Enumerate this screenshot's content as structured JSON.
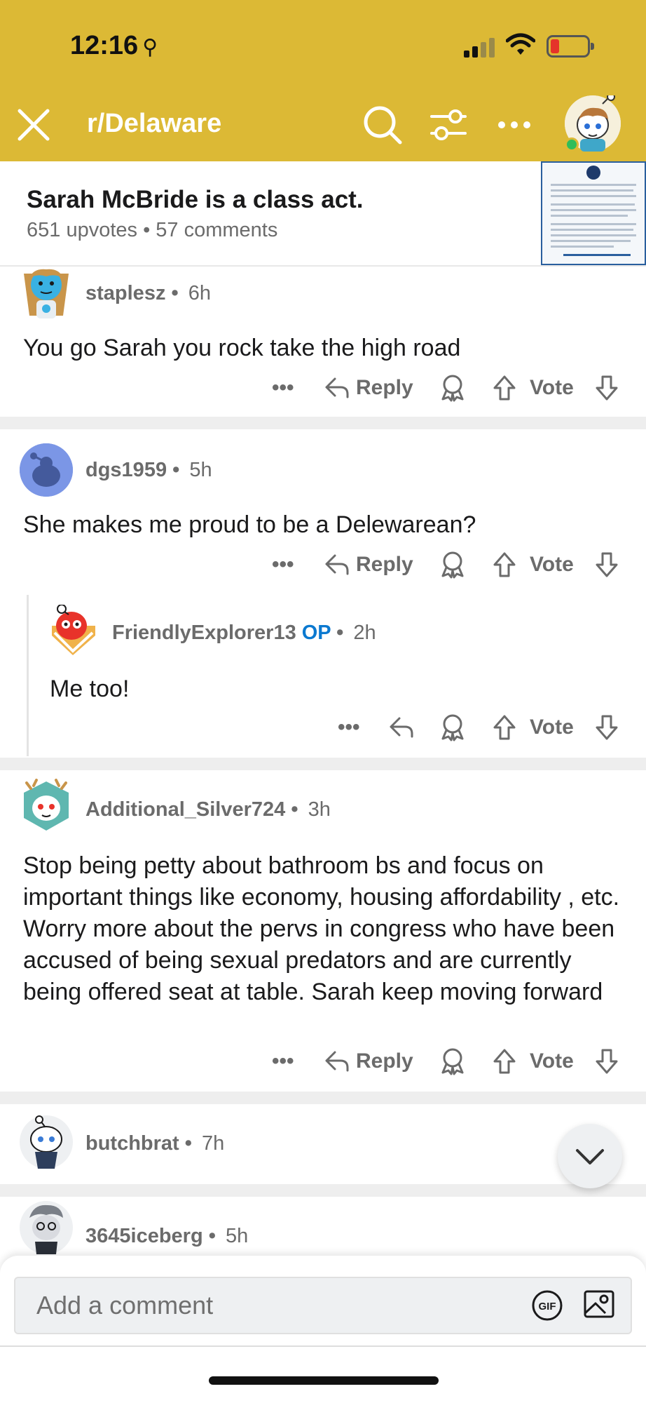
{
  "status_bar": {
    "time": "12:16",
    "pin_glyph": "⚲",
    "battery_color": "#e5332a"
  },
  "header": {
    "subreddit": "r/Delaware",
    "bg_color": "#dcb935"
  },
  "post": {
    "title": "Sarah McBride is a class act.",
    "upvotes": "651 upvotes",
    "separator": "•",
    "comments": "57 comments"
  },
  "actions": {
    "reply": "Reply",
    "vote": "Vote",
    "more": "•••"
  },
  "comments": [
    {
      "user": "staplesz",
      "time": "6h",
      "body": "You go Sarah you rock take the high road"
    },
    {
      "user": "dgs1959",
      "time": "5h",
      "body": "She makes me proud to be a Delewarean?"
    },
    {
      "user": "FriendlyExplorer13",
      "op": "OP",
      "time": "2h",
      "body": "Me too!"
    },
    {
      "user": "Additional_Silver724",
      "time": "3h",
      "body": "Stop being petty about bathroom bs and focus on important things like economy, housing affordability , etc.  Worry more about the pervs in congress who have been accused of being sexual predators and are currently being offered seat at table.  Sarah keep moving forward"
    },
    {
      "user": "butchbrat",
      "time": "7h"
    },
    {
      "user": "3645iceberg",
      "time": "5h"
    }
  ],
  "composer": {
    "placeholder": "Add a comment",
    "gif_label": "GIF"
  },
  "accent_colors": {
    "op": "#0b79d0",
    "meta_gray": "#6b6b6b"
  }
}
